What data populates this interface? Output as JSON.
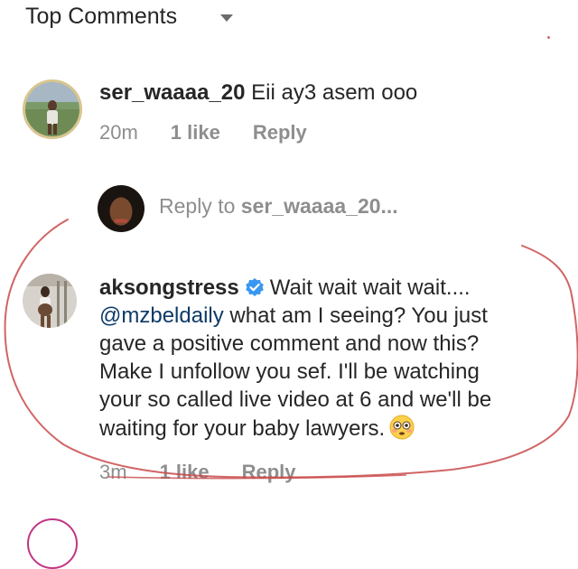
{
  "header": {
    "title": "Top Comments"
  },
  "comment1": {
    "username": "ser_waaaa_20",
    "text": "Eii ay3 asem ooo",
    "time": "20m",
    "likes": "1 like",
    "reply_label": "Reply"
  },
  "reply_prompt": {
    "prefix": "Reply to ",
    "username": "ser_waaaa_20..."
  },
  "comment2": {
    "username": "aksongstress",
    "line1": "Wait wait wait wait....",
    "mention": "@mzbeldaily",
    "line2": " what am I seeing? You just",
    "line3": "gave a positive comment and now this?",
    "line4": "Make I unfollow you sef. I'll be watching",
    "line5": "your so called live video at 6 and we'll be",
    "line6": "waiting for your baby lawyers.",
    "time": "3m",
    "likes": "1 like",
    "reply_label": "Reply"
  },
  "colors": {
    "text": "#262626",
    "meta": "#8e8e8e",
    "verified": "#3897f0",
    "annotation": "#c94a4a"
  }
}
